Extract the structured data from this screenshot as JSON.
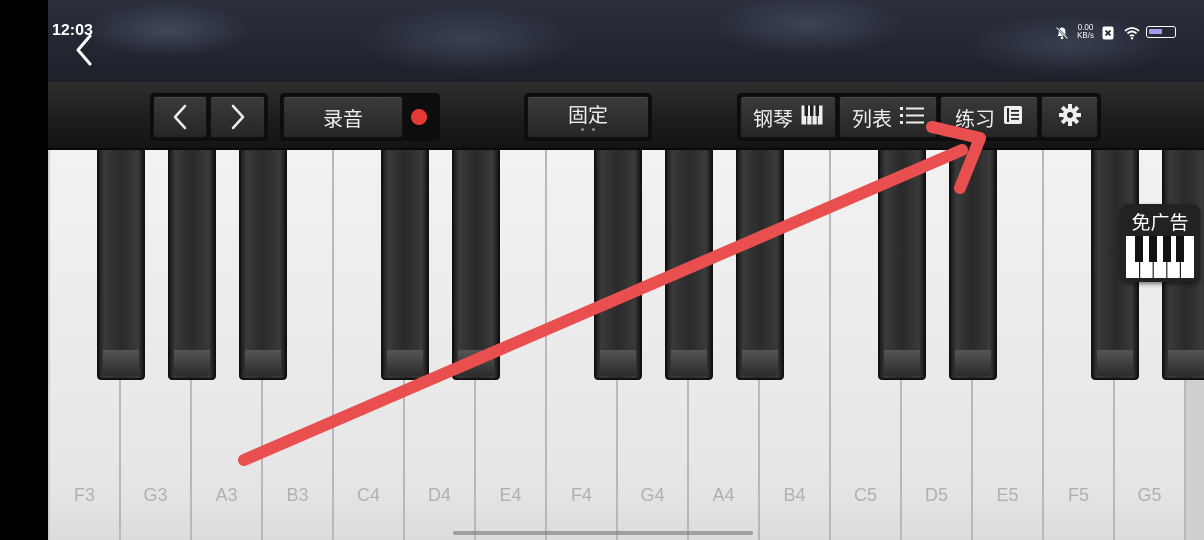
{
  "status_bar": {
    "time": "12:03",
    "net_speed_value": "0.00",
    "net_speed_unit": "KB/s",
    "battery_level": 0.55
  },
  "toolbar": {
    "record_label": "录音",
    "fixed_label": "固定",
    "piano_label": "钢琴",
    "list_label": "列表",
    "practice_label": "练习"
  },
  "ad": {
    "label": "免广告"
  },
  "keyboard": {
    "white_keys": [
      "F3",
      "G3",
      "A3",
      "B3",
      "C4",
      "D4",
      "E4",
      "F4",
      "G4",
      "A4",
      "B4",
      "C5",
      "D5",
      "E5",
      "F5",
      "G5"
    ]
  },
  "colors": {
    "accent_record": "#e53935",
    "annotation_arrow": "#ea4f4f"
  }
}
